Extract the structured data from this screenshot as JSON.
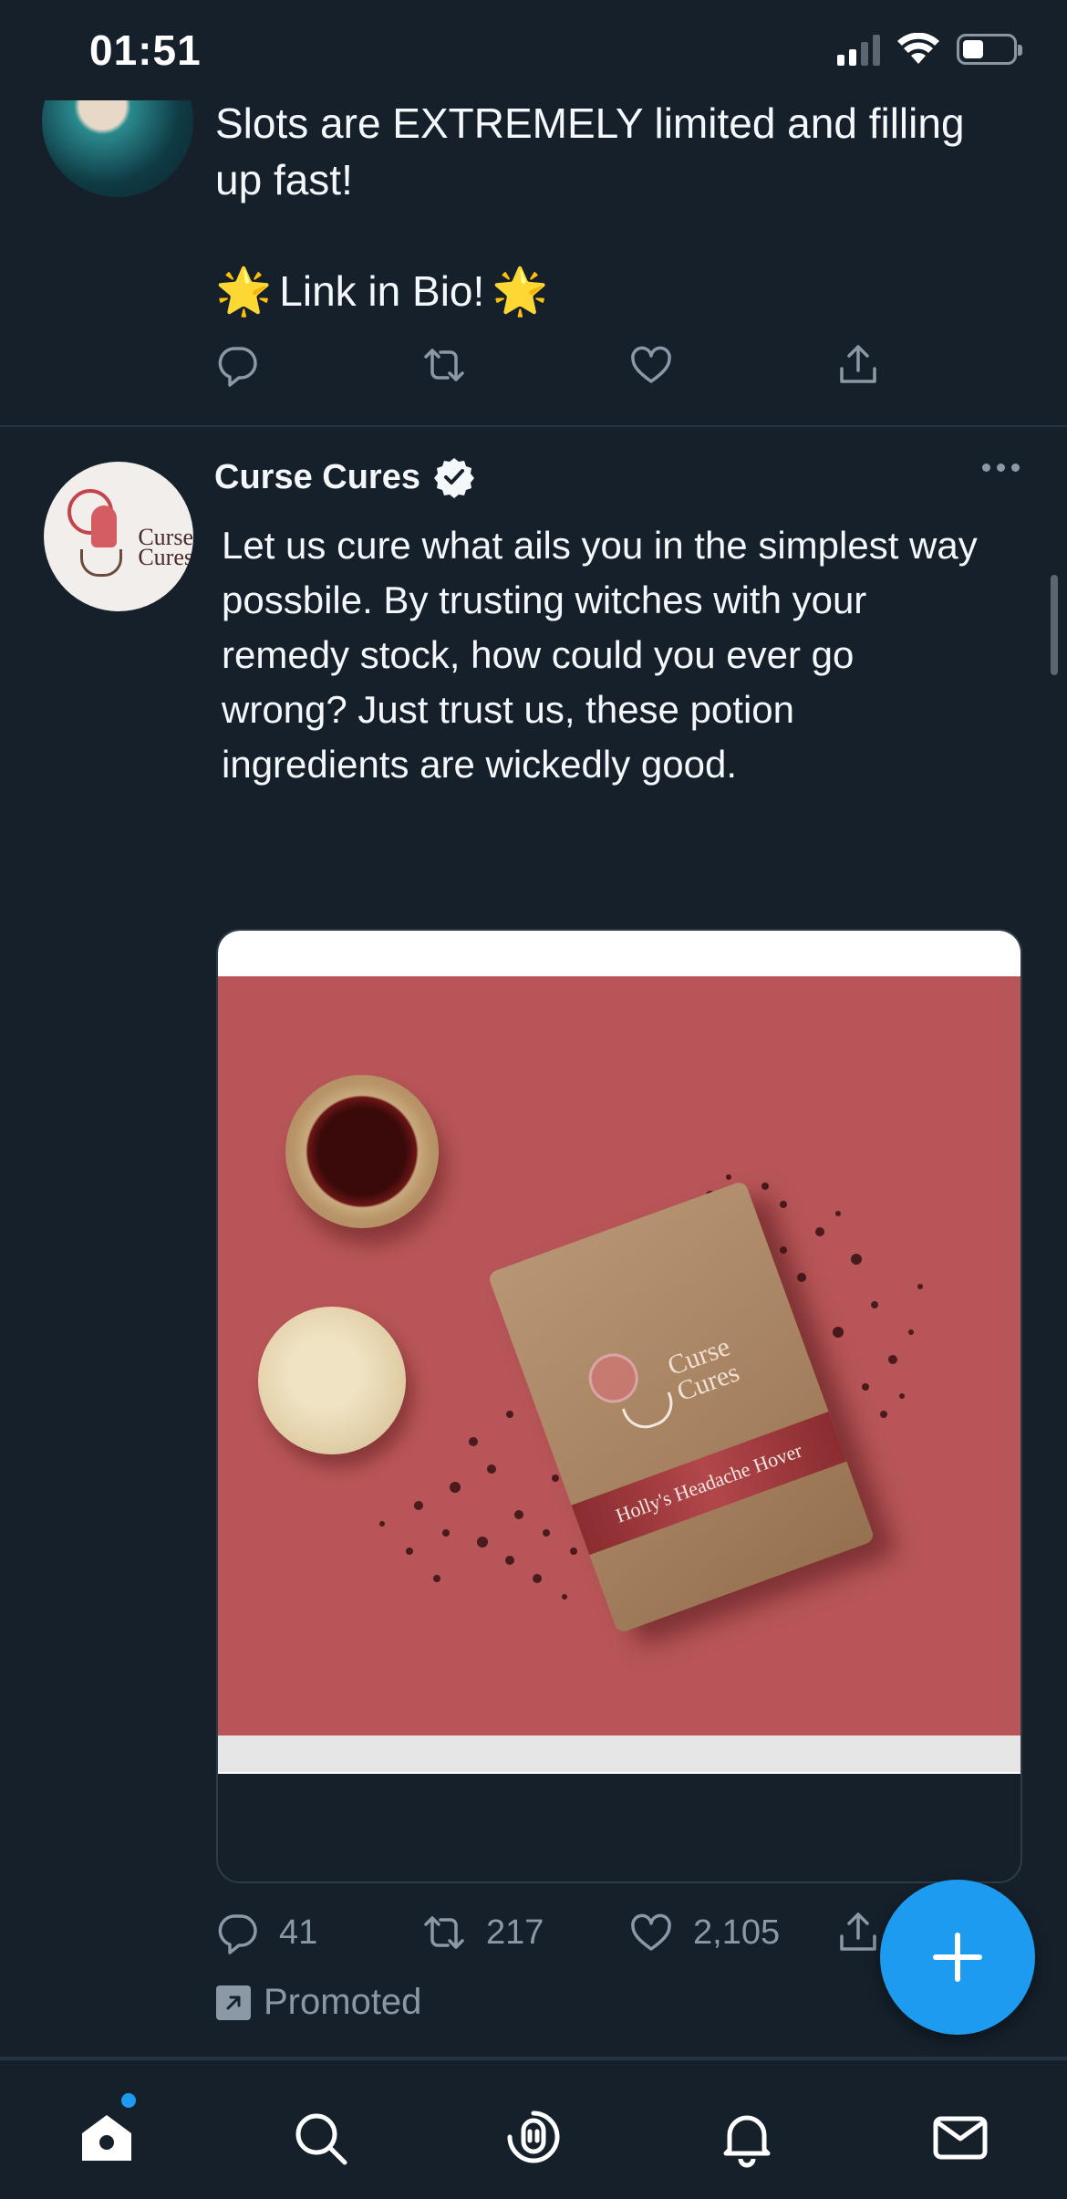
{
  "status_bar": {
    "time": "01:51"
  },
  "tweet_previous": {
    "text": "Slots are EXTREMELY limited and filling up fast!",
    "link_line": "Link in Bio!",
    "star_glyph": "🌟"
  },
  "tweet": {
    "author_name": "Curse Cures",
    "avatar_logo_text": "Curse Cures",
    "text": "Let us cure what ails you in the simplest way possbile. By trusting witches with your remedy stock, how could you ever go wrong? Just trust us, these potion ingredients are wickedly good.",
    "media": {
      "pouch_brand": "Curse Cures",
      "pouch_label": "Holly's Headache Hover"
    },
    "stats": {
      "replies": "41",
      "retweets": "217",
      "likes": "2,105"
    },
    "promoted_label": "Promoted"
  },
  "colors": {
    "background": "#15202b",
    "accent": "#1d9bf0",
    "muted": "#8b98a5",
    "photo_background": "#b85558"
  },
  "icons": {
    "reply": "reply-icon",
    "retweet": "retweet-icon",
    "like": "heart-icon",
    "share": "share-icon",
    "compose": "plus-icon",
    "nav": [
      "home-icon",
      "search-icon",
      "spaces-icon",
      "notifications-icon",
      "messages-icon"
    ]
  }
}
